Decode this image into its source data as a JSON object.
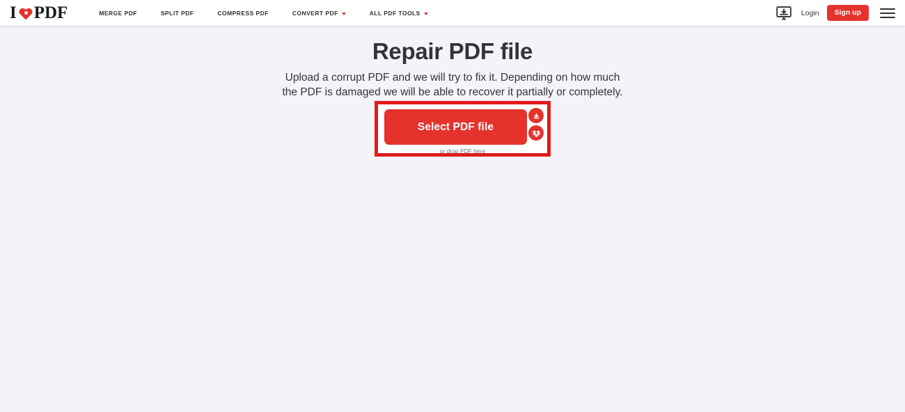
{
  "header": {
    "logo": {
      "text_left": "I",
      "text_right": "PDF",
      "heart_icon": "heart-icon",
      "brand_color": "#e5322d"
    },
    "nav_items": [
      {
        "label": "MERGE PDF",
        "has_dropdown": false
      },
      {
        "label": "SPLIT PDF",
        "has_dropdown": false
      },
      {
        "label": "COMPRESS PDF",
        "has_dropdown": false
      },
      {
        "label": "CONVERT PDF",
        "has_dropdown": true
      },
      {
        "label": "ALL PDF TOOLS",
        "has_dropdown": true
      }
    ],
    "desktop_icon": "desktop-download-icon",
    "login_label": "Login",
    "signup_label": "Sign up",
    "menu_icon": "hamburger-menu-icon"
  },
  "main": {
    "title": "Repair PDF file",
    "subtitle": "Upload a corrupt PDF and we will try to fix it. Depending on how much the PDF is damaged we will be able to recover it partially or completely.",
    "select_button_label": "Select PDF file",
    "drop_text": "or drop PDF here",
    "cloud_buttons": [
      {
        "name": "google-drive-button",
        "icon": "google-drive-icon"
      },
      {
        "name": "dropbox-button",
        "icon": "dropbox-icon"
      }
    ]
  },
  "colors": {
    "brand_red": "#e5322d",
    "highlight_red": "#e01c1c",
    "page_background": "#f4f4f8",
    "heading": "#33333d"
  }
}
